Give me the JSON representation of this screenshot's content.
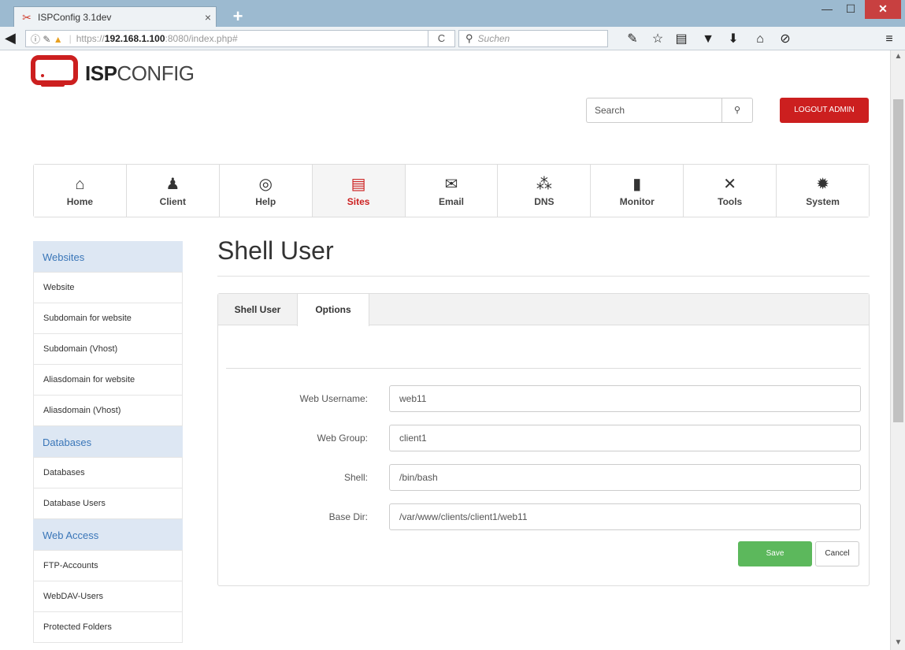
{
  "browser": {
    "tab_title": "ISPConfig 3.1dev",
    "tab_close": "×",
    "new_tab": "+",
    "url_prefix": "https://",
    "url_host": "192.168.1.100",
    "url_rest": ":8080/index.php#",
    "reload": "C",
    "search_placeholder": "Suchen",
    "window_min": "—",
    "window_max": "☐",
    "window_close": "✕"
  },
  "header": {
    "logo_bold": "ISP",
    "logo_light": "CONFIG",
    "search_placeholder": "Search",
    "logout_label": "LOGOUT ADMIN"
  },
  "main_nav": {
    "items": [
      {
        "label": "Home",
        "icon": "home-icon"
      },
      {
        "label": "Client",
        "icon": "users-icon"
      },
      {
        "label": "Help",
        "icon": "lifebuoy-icon"
      },
      {
        "label": "Sites",
        "icon": "browser-window-icon",
        "active": true
      },
      {
        "label": "Email",
        "icon": "envelope-icon"
      },
      {
        "label": "DNS",
        "icon": "network-icon"
      },
      {
        "label": "Monitor",
        "icon": "traffic-light-icon"
      },
      {
        "label": "Tools",
        "icon": "tools-icon"
      },
      {
        "label": "System",
        "icon": "gear-icon"
      }
    ]
  },
  "sidebar": {
    "sections": [
      {
        "title": "Websites",
        "items": [
          "Website",
          "Subdomain for website",
          "Subdomain (Vhost)",
          "Aliasdomain for website",
          "Aliasdomain (Vhost)"
        ]
      },
      {
        "title": "Databases",
        "items": [
          "Databases",
          "Database Users"
        ]
      },
      {
        "title": "Web Access",
        "items": [
          "FTP-Accounts",
          "WebDAV-Users",
          "Protected Folders"
        ]
      }
    ]
  },
  "content": {
    "page_title": "Shell User",
    "tabs": [
      "Shell User",
      "Options"
    ],
    "fields": [
      {
        "label": "Web Username:",
        "value": "web11"
      },
      {
        "label": "Web Group:",
        "value": "client1"
      },
      {
        "label": "Shell:",
        "value": "/bin/bash"
      },
      {
        "label": "Base Dir:",
        "value": "/var/www/clients/client1/web11"
      }
    ],
    "save_label": "Save",
    "cancel_label": "Cancel"
  },
  "colors": {
    "brand_red": "#cc1f1f",
    "save_green": "#5cb85c",
    "sidebar_header_bg": "#dde7f3",
    "sidebar_header_text": "#3a76b8"
  }
}
